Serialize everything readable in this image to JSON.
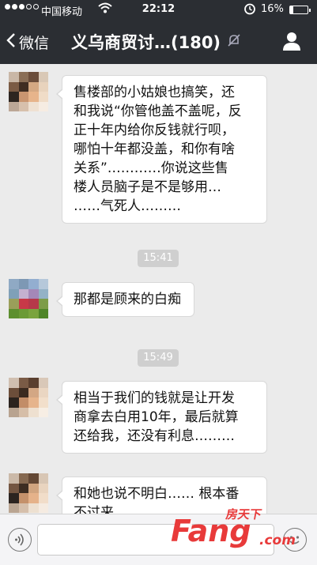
{
  "status_bar": {
    "carrier": "中国移动",
    "time": "22:12",
    "battery": "16%",
    "battery_level": 0.16
  },
  "nav": {
    "back_label": "微信",
    "title": "义乌商贸讨…(180)"
  },
  "messages": [
    {
      "lines": [
        "售楼部的小姑娘也搞笑，还",
        "和我说“你管他盖不盖呢，反",
        "正十年内给你反钱就行呗，",
        "哪怕十年都没盖，和你有啥",
        "关系”…………你说这些售",
        "楼人员脑子是不是够用…",
        "……气死人………"
      ]
    },
    {
      "lines": [
        "那都是顾来的白痴"
      ]
    },
    {
      "lines": [
        "相当于我们的钱就是让开发",
        "商拿去白用10年，最后就算",
        "还给我，还没有利息………"
      ]
    },
    {
      "lines": [
        "和她也说不明白…… 根本番",
        "不过来"
      ]
    }
  ],
  "timestamps": [
    "15:41",
    "15:49"
  ],
  "watermark": {
    "cn": "房天下",
    "en": "Fang",
    "domain": ".com"
  },
  "icons": {
    "back": "chevron-left-icon",
    "mute": "mute-bell-icon",
    "group_info": "people-icon",
    "voice": "voice-icon",
    "emoji": "emoji-icon"
  },
  "colors": {
    "navbar": "#2b2e33",
    "chat_background": "#ebebeb",
    "bubble": "#ffffff",
    "timestamp": "#cfcfcf"
  }
}
